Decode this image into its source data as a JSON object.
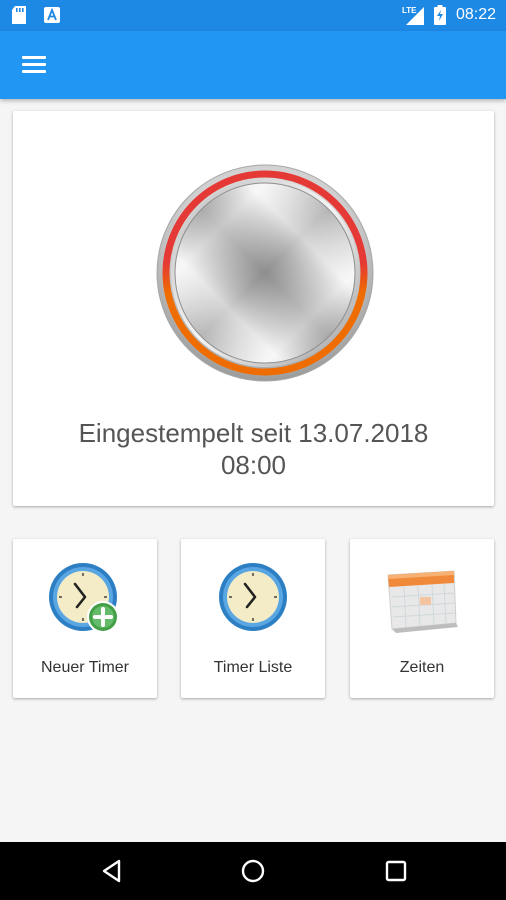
{
  "statusbar": {
    "time": "08:22",
    "left_icons": [
      "sd-card-icon",
      "app-notification-icon"
    ],
    "right_icons": [
      "lte-signal-icon",
      "battery-charging-icon"
    ]
  },
  "appbar": {
    "menu_icon": "hamburger-menu-icon",
    "colors": {
      "statusbar": "#1e88e5",
      "toolbar": "#2196f3"
    }
  },
  "main": {
    "status_line1": "Eingestempelt seit 13.07.2018",
    "status_line2": "08:00",
    "clock_ring_colors": [
      "#e53935",
      "#ef6c00"
    ]
  },
  "tiles": [
    {
      "label": "Neuer Timer",
      "icon": "clock-add-icon"
    },
    {
      "label": "Timer Liste",
      "icon": "clock-icon"
    },
    {
      "label": "Zeiten",
      "icon": "calendar-icon"
    }
  ],
  "navbar": {
    "buttons": [
      "back-icon",
      "home-icon",
      "recents-icon"
    ]
  }
}
